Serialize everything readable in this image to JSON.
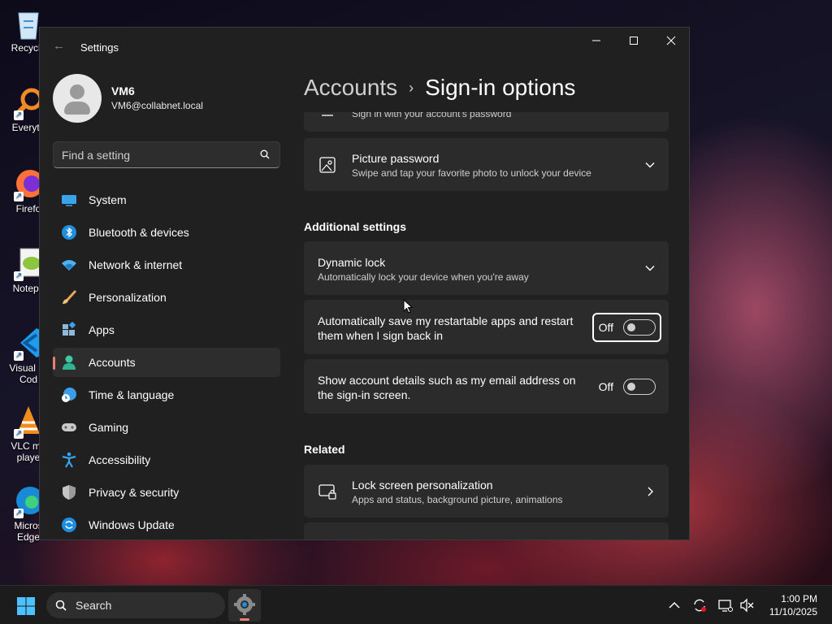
{
  "desktop": {
    "icons": [
      {
        "label": "Recycle",
        "icon": "recycle-bin-icon"
      },
      {
        "label": "Everyth",
        "icon": "everything-search-icon"
      },
      {
        "label": "Firefo",
        "icon": "firefox-icon"
      },
      {
        "label": "Notepa",
        "icon": "notepad-plus-plus-icon"
      },
      {
        "label": "Visual St\nCod",
        "icon": "vscode-icon"
      },
      {
        "label": "VLC me\nplaye",
        "icon": "vlc-icon"
      },
      {
        "label": "Micros\nEdge",
        "icon": "edge-icon"
      }
    ]
  },
  "window": {
    "title": "Settings",
    "controls": {
      "minimize": "minimize-icon",
      "maximize": "maximize-icon",
      "close": "close-icon"
    }
  },
  "profile": {
    "name": "VM6",
    "email": "VM6@collabnet.local"
  },
  "search": {
    "placeholder": "Find a setting"
  },
  "nav": {
    "items": [
      {
        "label": "System",
        "icon": "system-icon"
      },
      {
        "label": "Bluetooth & devices",
        "icon": "bluetooth-icon"
      },
      {
        "label": "Network & internet",
        "icon": "wifi-icon"
      },
      {
        "label": "Personalization",
        "icon": "brush-icon"
      },
      {
        "label": "Apps",
        "icon": "apps-icon"
      },
      {
        "label": "Accounts",
        "icon": "accounts-icon",
        "active": true
      },
      {
        "label": "Time & language",
        "icon": "globe-clock-icon"
      },
      {
        "label": "Gaming",
        "icon": "gamepad-icon"
      },
      {
        "label": "Accessibility",
        "icon": "accessibility-icon"
      },
      {
        "label": "Privacy & security",
        "icon": "shield-icon"
      },
      {
        "label": "Windows Update",
        "icon": "update-icon"
      }
    ]
  },
  "breadcrumb": {
    "parent": "Accounts",
    "separator": "›",
    "current": "Sign-in options"
  },
  "main": {
    "password_card": {
      "subtitle": "Sign in with your account's password"
    },
    "picture_password": {
      "title": "Picture password",
      "subtitle": "Swipe and tap your favorite photo to unlock your device"
    },
    "additional_settings": {
      "heading": "Additional settings",
      "dynamic_lock": {
        "title": "Dynamic lock",
        "subtitle": "Automatically lock your device when you're away"
      },
      "restart_apps": {
        "text": "Automatically save my restartable apps and restart them when I sign back in",
        "state": "Off"
      },
      "account_details": {
        "text": "Show account details such as my email address on the sign-in screen.",
        "state": "Off"
      }
    },
    "related": {
      "heading": "Related",
      "lock_screen": {
        "title": "Lock screen personalization",
        "subtitle": "Apps and status, background picture, animations"
      }
    }
  },
  "taskbar": {
    "search_label": "Search",
    "time": "1:00 PM",
    "date": "11/10/2025"
  },
  "colors": {
    "window_bg": "#202020",
    "card_bg": "#2b2b2b",
    "accent": "#e8816f",
    "taskbar_bg": "#1c1c1c"
  }
}
